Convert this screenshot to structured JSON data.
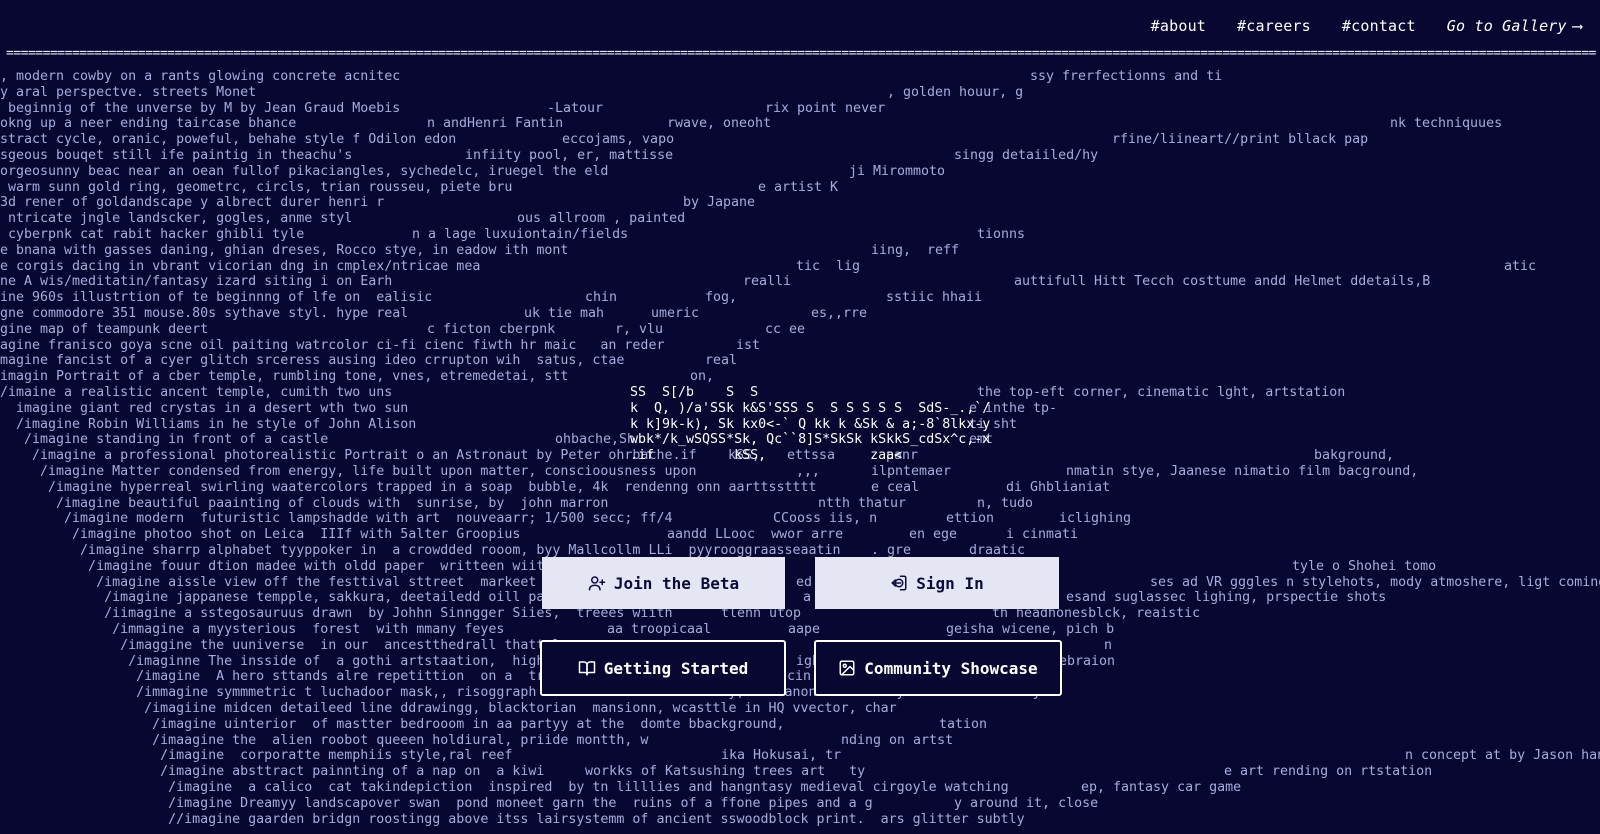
{
  "nav": {
    "about": "#about",
    "careers": "#careers",
    "contact": "#contact",
    "gallery": "Go to Gallery",
    "gallery_arrow": "⟶"
  },
  "rule": "==================================================================================================================================================================================================================================",
  "background_lines": [
    [
      [
        0,
        ", modern cowby on a rants glowing concrete acnitec"
      ],
      [
        1030,
        "ssy frerfectionns and ti"
      ]
    ],
    [
      [
        0,
        "y aral perspectve. streets Monet"
      ],
      [
        887,
        ", golden houur, g"
      ]
    ],
    [
      [
        0,
        " beginnig of the unverse by M by Jean Graud Moebis"
      ],
      [
        547,
        "-Latour"
      ],
      [
        765,
        "rix point never"
      ]
    ],
    [
      [
        0,
        "okng up a neer ending taircase bhance"
      ],
      [
        427,
        "n andHenri Fantin"
      ],
      [
        667,
        "rwave, oneoht"
      ],
      [
        1390,
        "nk techniquues"
      ]
    ],
    [
      [
        0,
        "stract cycle, oranic, poweful, behahe style f Odilon edon"
      ],
      [
        562,
        "eccojams, vapo"
      ],
      [
        1112,
        "rfine/liineart//print bllack pap"
      ]
    ],
    [
      [
        0,
        "sgeous bouqet still ife paintig in theachu's"
      ],
      [
        465,
        "infiity pool, er, mattisse"
      ],
      [
        954,
        "singg detaiiled/hy"
      ]
    ],
    [
      [
        0,
        "orgeosunny beac near an oean fullof pikaciangles, sychedelc, iruegel the eld"
      ],
      [
        849,
        "ji Mirommoto"
      ]
    ],
    [
      [
        0,
        " warm sunn gold ring, geometrc, circls, trian rousseu, piete bru"
      ],
      [
        758,
        "e artist K"
      ]
    ],
    [
      [
        0,
        "3d rener of goldandscape y albrect durer henri r"
      ],
      [
        683,
        "by Japane"
      ]
    ],
    [
      [
        0,
        " ntricate jngle landscker, gogles, anme styl"
      ],
      [
        517,
        "ous allroom , painted"
      ]
    ],
    [
      [
        0,
        " cyberpnk cat rabit hacker ghibli tyle"
      ],
      [
        412,
        "n a lage luxuiontain/fields"
      ],
      [
        977,
        "tionns"
      ]
    ],
    [
      [
        0,
        "e bnana with gasses daning, ghian dreses, Rocco stye, in eadow ith mont"
      ],
      [
        871,
        "iing,  reff"
      ]
    ],
    [
      [
        0,
        "e corgis dacing in vbrant vicorian dng in cmplex/ntricae mea"
      ],
      [
        796,
        "tic  lig"
      ],
      [
        1504,
        "atic"
      ]
    ],
    [
      [
        0,
        "ne A wis/meditatin/fantasy izard siting i on Earh"
      ],
      [
        743,
        "realli"
      ],
      [
        1014,
        "auttifull Hitt Tecch costtume andd Helmet ddetails,B"
      ]
    ],
    [
      [
        0,
        "ine 960s illustrtion of te beginnng of lfe on  ealisic"
      ],
      [
        585,
        "chin"
      ],
      [
        705,
        "fog,"
      ],
      [
        886,
        "sstiic hhaii"
      ]
    ],
    [
      [
        0,
        "gne commodore 351 mouse.80s sythave styl. hype real"
      ],
      [
        524,
        "uk tie mah"
      ],
      [
        651,
        "umeric"
      ],
      [
        811,
        "es,,rre"
      ]
    ],
    [
      [
        0,
        "gine map of teampunk deert"
      ],
      [
        427,
        "c ficton cberpnk"
      ],
      [
        615,
        "r, vlu"
      ],
      [
        765,
        "cc ee"
      ]
    ],
    [
      [
        0,
        "agine franisco goya scne oil paiting watrcolor ci-fi cienc fiwth hr maic   an reder"
      ],
      [
        736,
        "ist"
      ]
    ],
    [
      [
        0,
        "magine fancist of a cyer glitch srceress ausing ideo crrupton wih  satus, ctae"
      ],
      [
        705,
        "real"
      ]
    ],
    [
      [
        0,
        "imagin Portrait of a cber temple, rumbling tone, vnes, etremedetai, stt"
      ],
      [
        690,
        "on,"
      ]
    ],
    [
      [
        0,
        "/imaine a realistic ancent temple, cumith two uns"
      ],
      [
        977,
        "the top-eft corner, cinematic lght, artstation"
      ]
    ],
    [
      [
        0,
        "  imagine giant red crystas in a desert wth two sun"
      ],
      [
        969,
        "e inthe tp-"
      ]
    ],
    [
      [
        0,
        "  /imagine Robin Williams in he style of John Alison"
      ],
      [
        969,
        "ti sht"
      ]
    ],
    [
      [
        0,
        "   /imagine standing in front of a castle"
      ],
      [
        555,
        "ohbache,Sh"
      ],
      [
        969,
        "emt"
      ]
    ],
    [
      [
        0,
        "    /imagine a professional photorealistic Portrait o an Astronaut by Peter ohrbache.if"
      ],
      [
        728,
        "kSS,"
      ],
      [
        787,
        "ettssa"
      ],
      [
        886,
        "panr"
      ],
      [
        1314,
        "bakground,"
      ]
    ],
    [
      [
        0,
        "     /imagine Matter condensed from energy, life built upon matter, conscioousness upon"
      ],
      [
        796,
        ",,,"
      ],
      [
        871,
        "ilpntemaer"
      ],
      [
        1066,
        "nmatin stye, Jaanese nimatio film bacground,"
      ]
    ],
    [
      [
        0,
        "      /imagine hyperreal swirling waatercolors trapped in a soap  bubble, 4k  rendenng onn aarttsstttt"
      ],
      [
        871,
        "e ceal"
      ],
      [
        1006,
        "di Ghblianiat"
      ]
    ],
    [
      [
        0,
        "       /imagine beautiful paainting of clouds with  sunrise, by  john marron"
      ],
      [
        818,
        "ntth thatur"
      ],
      [
        977,
        "n, tudo"
      ]
    ],
    [
      [
        0,
        "        /imagine modern  futuristic lampshadde with art  nouveaarr; 1/500 secc; ff/4"
      ],
      [
        773,
        "CCooss iis, n"
      ],
      [
        946,
        "ettion"
      ],
      [
        1059,
        "iclighing"
      ]
    ],
    [
      [
        0,
        "         /imagine photoo shot on Leica  IIIf with 5alter Groopius"
      ],
      [
        667,
        "aandd LLooc  wwor arre"
      ],
      [
        909,
        "en ege"
      ],
      [
        1006,
        "i cinmati"
      ]
    ],
    [
      [
        0,
        "          /imagine sharrp alphabet tyyppoker in  a crowdded rooom, byy Mallcollm LLi  pyyrooggraasseaatin"
      ],
      [
        871,
        ". gre"
      ],
      [
        969,
        "draatic"
      ]
    ],
    [
      [
        0,
        "           /imagine fouur dtion madee with oldd paper  writteen wiith cc"
      ],
      [
        1292,
        "tyle o Shohei tomo"
      ]
    ],
    [
      [
        0,
        "            /imagine aissle view off the festtival sttreet  markeet inn"
      ],
      [
        796,
        "ed"
      ],
      [
        1150,
        "ses ad VR gggles n stylehots, mody atmoshere, ligt coming f"
      ]
    ],
    [
      [
        0,
        "             /imagine jappanese tempple, sakkura, deetailedd oill paitt"
      ],
      [
        803,
        "a"
      ],
      [
        1066,
        "esand suglassec lighing, prspectie shots"
      ]
    ],
    [
      [
        0,
        "             /iimagine a sstegosauruus drawn  by Johhn Sinngger Siies,  treees wiith"
      ],
      [
        721,
        "tlenn utop"
      ],
      [
        992,
        "th headhonesblck, reaistic"
      ]
    ],
    [
      [
        0,
        "              /immagine a myysterious  forest  with mmany feyes"
      ],
      [
        607,
        "aa troopicaal"
      ],
      [
        788,
        "aape"
      ],
      [
        946,
        "geisha wicene, pich b"
      ]
    ],
    [
      [
        0,
        "               /imaggine the uuniverse  in our  ancestthedrall thatt loo"
      ],
      [
        1104,
        "n"
      ]
    ],
    [
      [
        0,
        "                /imaginne The insside of  a gothi artstaation,  highlly"
      ],
      [
        796,
        "igh"
      ],
      [
        1059,
        "ebraion"
      ]
    ],
    [
      [
        0,
        "                 /imagine  A hero sttands alre repetittion  on a  tree o"
      ],
      [
        787,
        "cin"
      ]
    ],
    [
      [
        0,
        "                 /immagine symmmetric t luchadoor mask,, risoggraph  nd wwoods aand   fooddy, aan anonimmcc Ciity. Hotteil nrcraly"
      ]
    ],
    [
      [
        0,
        "                  /imagiine midcen detaileed line ddrawingg, blacktorian  mansionn, wcasttle in HQ vvector, char"
      ]
    ],
    [
      [
        0,
        "                   /imagine uinterior  of mastter bedrooom in aa partyy at the  domte bbackground,"
      ],
      [
        939,
        "tation"
      ]
    ],
    [
      [
        0,
        "                   /imaagine the  alien roobot queeen holdiural, priide montth, w"
      ],
      [
        841,
        "nding on artst"
      ]
    ],
    [
      [
        0,
        "                    /imagine  corporatte memphiis style,ral reef"
      ],
      [
        721,
        "ika Hokusai, tr"
      ],
      [
        1405,
        "n concept at by Jason han"
      ]
    ],
    [
      [
        0,
        "                    /imagine absttract painnting of a nap on  a kiwi"
      ],
      [
        585,
        "workks of Katsushing trees art   ty"
      ],
      [
        1224,
        "e art rending on rtstation"
      ]
    ],
    [
      [
        0,
        "                     /imagine  a calico  cat takindepiction  inspired  by tn lilllies and hangntasy medieval cirgoyle watching"
      ],
      [
        1081,
        "ep, fantasy car game"
      ]
    ],
    [
      [
        0,
        "                     /imagine Dreamyy landscapover swan  pond moneet garn the  ruins of a ffone pipes and a g"
      ],
      [
        954,
        "y around it, close"
      ]
    ],
    [
      [
        0,
        "                     //imagine gaarden bridgn roostingg above itss lairsystemm of ancient sswoodblock print.  ars glitter subtly"
      ]
    ]
  ],
  "ascii_art": "SS  S[/b    S  S\nk  Q, )/a'SSk k&S'SSS S  S S S S S  SdS-_.,`/\nk k]9k-k), Sk kx0<-` Q kk k &Sk & a;-8`8lkx-y\nwbk*/k_wSQSS*Sk, Qc``8]S*SkSk kSkkS_cdSx^c,-x\n.if          kSS,             zaa<",
  "buttons": {
    "join": "Join the Beta",
    "sign_in": "Sign In",
    "getting_started": "Getting Started",
    "showcase": "Community Showcase"
  },
  "colors": {
    "background": "#070732",
    "bg_text": "#a7acdd",
    "light_button": "#e5e6f4",
    "white": "#ffffff"
  },
  "icons": {
    "join": "user-plus-icon",
    "sign_in": "login-icon",
    "getting_started": "book-open-icon",
    "showcase": "image-icon"
  }
}
